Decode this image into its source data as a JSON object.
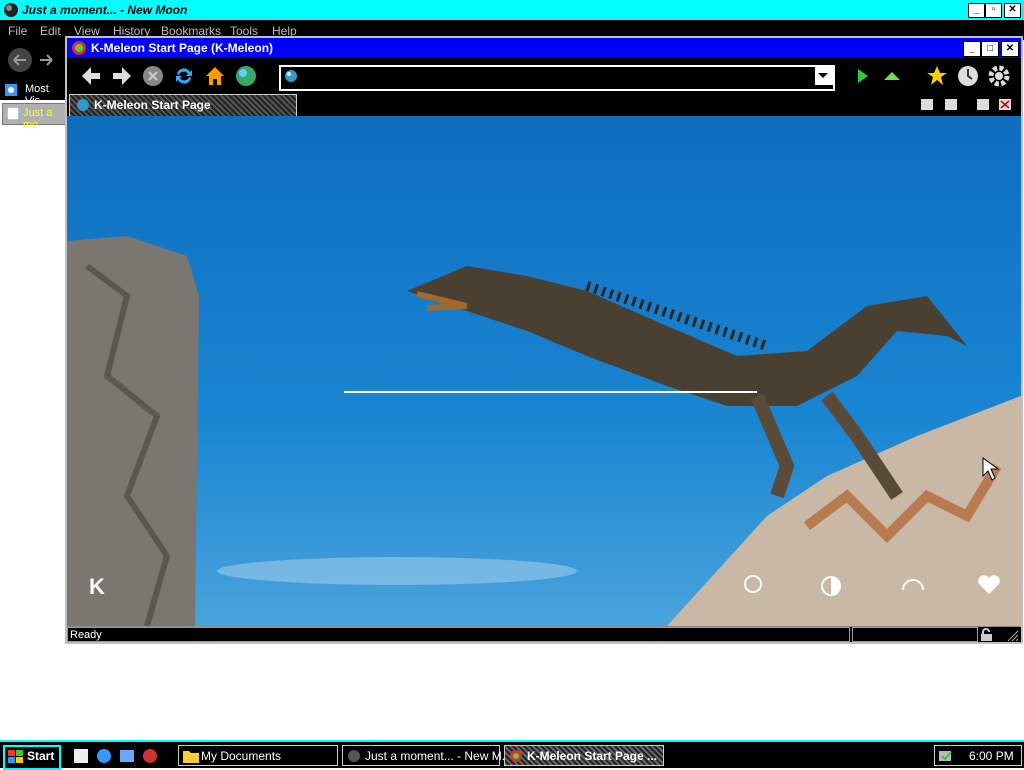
{
  "background_window": {
    "title": "Just a moment... - New Moon",
    "menu": [
      "File",
      "Edit",
      "View",
      "History",
      "Bookmarks",
      "Tools",
      "Help"
    ],
    "bookmark_label": "Most Vis",
    "tab_label": "Just a mo"
  },
  "kmeleon": {
    "title": "K-Meleon Start Page (K-Meleon)",
    "tab_label": "K-Meleon Start Page",
    "url_value": "",
    "status_text": "Ready",
    "start_page_logo": "K"
  },
  "taskbar": {
    "start_label": "Start",
    "tasks": [
      "My Documents",
      "Just a moment... - New M...",
      "K-Meleon Start Page ..."
    ],
    "clock": "6:00 PM"
  },
  "colors": {
    "bg_titlebar": "#00ffff",
    "km_titlebar": "#0000ff",
    "sky": "#1a86d2"
  }
}
